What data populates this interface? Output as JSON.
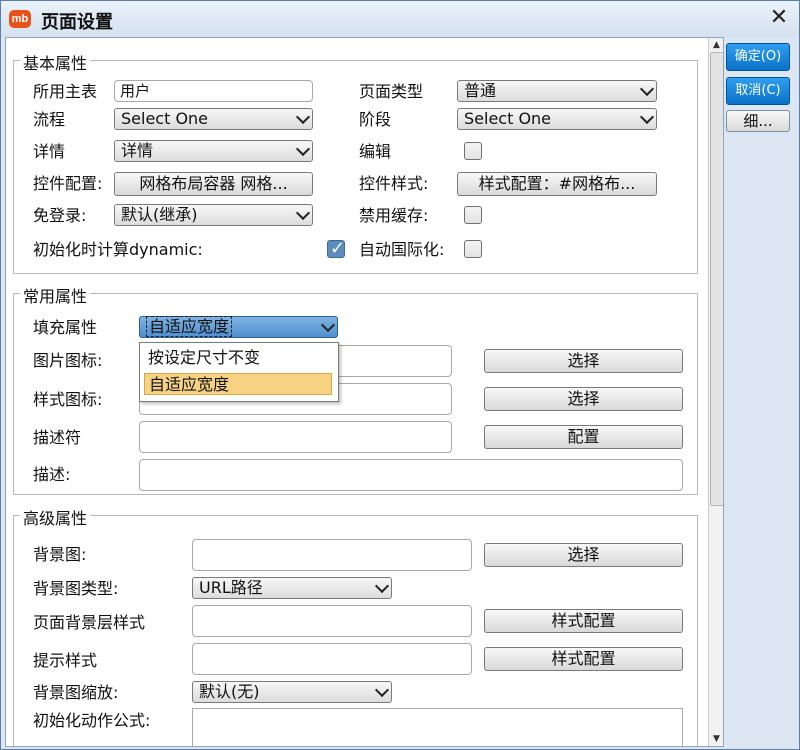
{
  "window": {
    "title": "页面设置",
    "app_icon": "mb"
  },
  "side_buttons": {
    "ok": "确定(O)",
    "cancel": "取消(C)",
    "detail": "细..."
  },
  "basic": {
    "legend": "基本属性",
    "main_table_label": "所用主表",
    "main_table_value": "用户",
    "page_type_label": "页面类型",
    "page_type_value": "普通",
    "flow_label": "流程",
    "flow_value": "Select One",
    "stage_label": "阶段",
    "stage_value": "Select One",
    "detail_label": "详情",
    "detail_value": "详情",
    "edit_label": "编辑",
    "control_config_label": "控件配置:",
    "control_config_value": "网格布局容器  网格...",
    "control_style_label": "控件样式:",
    "control_style_value": "样式配置：#网格布...",
    "no_login_label": "免登录:",
    "no_login_value": "默认(继承)",
    "disable_cache_label": "禁用缓存:",
    "init_dynamic_label": "初始化时计算dynamic:",
    "auto_i18n_label": "自动国际化:"
  },
  "common": {
    "legend": "常用属性",
    "fill_label": "填充属性",
    "fill_value": "自适应宽度",
    "fill_options": [
      "按设定尺寸不变",
      "自适应宽度"
    ],
    "picture_icon_label": "图片图标:",
    "picture_icon_btn": "选择",
    "style_icon_label": "样式图标:",
    "style_icon_btn": "选择",
    "descriptor_label": "描述符",
    "descriptor_btn": "配置",
    "description_label": "描述:"
  },
  "advanced": {
    "legend": "高级属性",
    "bg_image_label": "背景图:",
    "bg_image_btn": "选择",
    "bg_type_label": "背景图类型:",
    "bg_type_value": "URL路径",
    "bg_layer_label": "页面背景层样式",
    "bg_layer_btn": "样式配置",
    "hint_style_label": "提示样式",
    "hint_style_btn": "样式配置",
    "bg_scale_label": "背景图缩放:",
    "bg_scale_value": "默认(无)",
    "init_action_label": "初始化动作公式:"
  }
}
